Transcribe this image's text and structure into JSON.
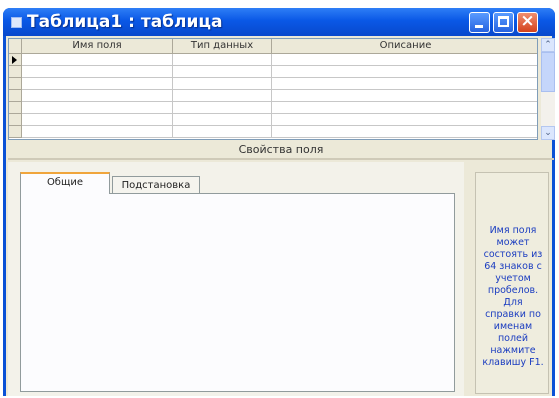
{
  "window": {
    "title": "Таблица1 : таблица"
  },
  "grid": {
    "columns": [
      "Имя поля",
      "Тип данных",
      "Описание"
    ],
    "row_count": 7
  },
  "properties": {
    "caption": "Свойства поля",
    "tabs": [
      "Общие",
      "Подстановка"
    ],
    "active_tab": "Общие"
  },
  "help": {
    "lines": [
      "Имя поля",
      "может",
      "состоять из",
      "64 знаков с",
      "учетом",
      "пробелов.",
      "Для",
      "справки по",
      "именам",
      "полей",
      "нажмите",
      "клавишу F1."
    ]
  },
  "scrollbar": {
    "up_glyph": "⌃",
    "down_glyph": "⌄"
  },
  "title_buttons": {
    "close_glyph": "×"
  }
}
